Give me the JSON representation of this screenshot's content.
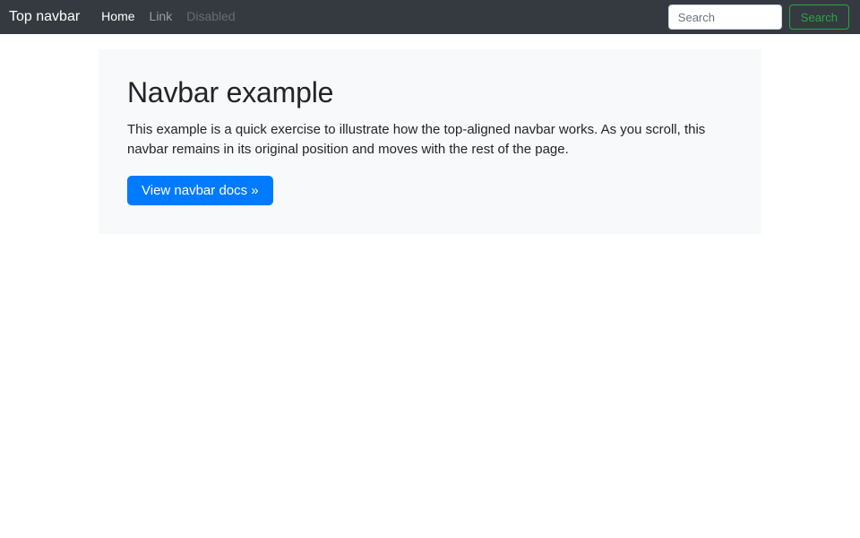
{
  "navbar": {
    "brand": "Top navbar",
    "links": [
      {
        "label": "Home",
        "state": "active"
      },
      {
        "label": "Link",
        "state": "normal"
      },
      {
        "label": "Disabled",
        "state": "disabled"
      }
    ],
    "search": {
      "placeholder": "Search",
      "button_label": "Search"
    }
  },
  "jumbotron": {
    "title": "Navbar example",
    "description": "This example is a quick exercise to illustrate how the top-aligned navbar works. As you scroll, this navbar remains in its original position and moves with the rest of the page.",
    "cta_label": "View navbar docs »"
  },
  "colors": {
    "navbar-bg": "#343a40",
    "jumbotron-bg": "#f8f9fa",
    "primary": "#007bff",
    "success": "#28a745",
    "text": "#212529"
  }
}
